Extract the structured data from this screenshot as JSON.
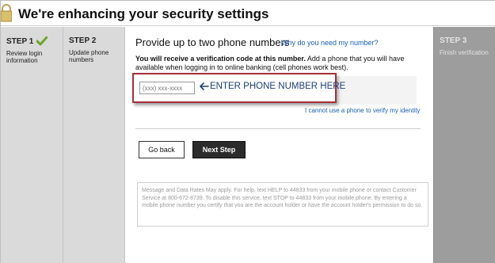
{
  "header": {
    "title": "We're enhancing your security settings",
    "lock_icon": "lock-icon"
  },
  "steps": [
    {
      "title": "STEP 1",
      "description": "Review login information",
      "state": "completed",
      "icon": "checkmark-icon"
    },
    {
      "title": "STEP 2",
      "description": "Update phone numbers",
      "state": "current"
    },
    {
      "title": "STEP 3",
      "description": "Finish verification",
      "state": "upcoming"
    }
  ],
  "main": {
    "section_title": "Provide up to two phone numbers",
    "why_link": "Why do you need my number?",
    "info_bold": "You will receive a verification code at this number.",
    "info_rest": " Add a phone that you will have available when logging in to online banking (cell phones work best).",
    "phone_placeholder": "(xxx) xxx-xxxx",
    "enter_note": "ENTER PHONE NUMBER HERE",
    "cannot_link": "I cannot use a phone to verify my identity",
    "go_back_label": "Go back",
    "next_step_label": "Next Step",
    "disclaimer": "Message and Data Rates May apply. For help, text HELP to 44833 from your mobile phone or contact Customer Service at 800-672-8739. To disable this service, text STOP to 44833 from your mobile phone. By entering a mobile phone number you certify that you are the account holder or have the account holder's permission to do so."
  },
  "colors": {
    "highlight_border": "#a3303a",
    "link": "#1a5fb4",
    "arrow_text": "#1c3f75",
    "check": "#6aa52b",
    "next_button_bg": "#2b2b2b",
    "inactive_step_bg": "#dadada",
    "future_step_bg": "#9d9d9d"
  }
}
